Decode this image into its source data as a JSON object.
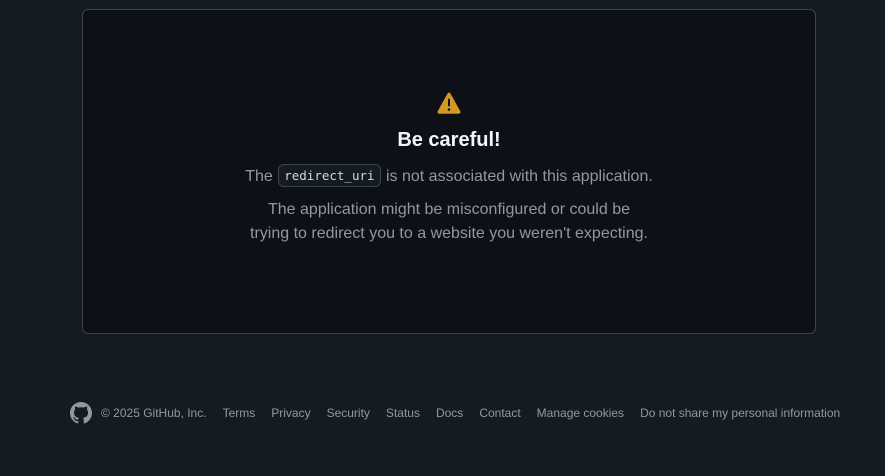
{
  "card": {
    "icon": "alert-icon",
    "title": "Be careful!",
    "line1_prefix": "The",
    "line1_code": "redirect_uri",
    "line1_suffix": "is not associated with this application.",
    "line2_a": "The application might be misconfigured or could be",
    "line2_b": "trying to redirect you to a website you weren't expecting."
  },
  "footer": {
    "logo": "github-mark-icon",
    "copyright": "© 2025 GitHub, Inc.",
    "links": [
      {
        "label": "Terms"
      },
      {
        "label": "Privacy"
      },
      {
        "label": "Security"
      },
      {
        "label": "Status"
      },
      {
        "label": "Docs"
      },
      {
        "label": "Contact"
      },
      {
        "label": "Manage cookies"
      },
      {
        "label": "Do not share my personal information"
      }
    ]
  },
  "colors": {
    "page_bg": "#151b23",
    "card_bg": "#0d1117",
    "border": "#3d444d",
    "title": "#f0f6fc",
    "muted": "#9198a1",
    "warning": "#d29922"
  }
}
